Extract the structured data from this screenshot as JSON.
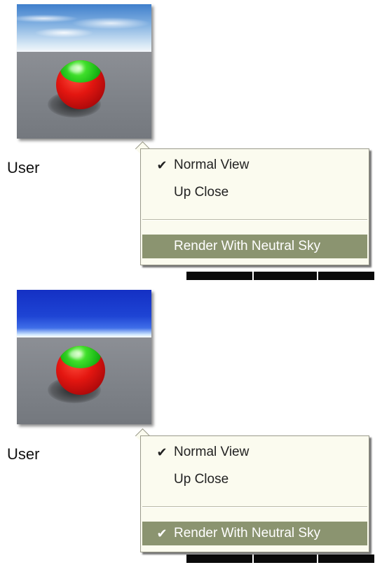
{
  "panels": [
    {
      "sky": "cloudy",
      "profile_label": "User",
      "menu": {
        "items": [
          {
            "label": "Normal View",
            "checked": true
          },
          {
            "label": "Up Close",
            "checked": false
          },
          {
            "label": "Render With Neutral Sky",
            "checked": false,
            "highlighted": true
          }
        ],
        "check_glyph": "✔"
      }
    },
    {
      "sky": "neutral",
      "profile_label": "User",
      "menu": {
        "items": [
          {
            "label": "Normal View",
            "checked": true
          },
          {
            "label": "Up Close",
            "checked": false
          },
          {
            "label": "Render With Neutral Sky",
            "checked": true,
            "highlighted": true
          }
        ],
        "check_glyph": "✔"
      }
    }
  ],
  "colors": {
    "menu_bg": "#fbfbef",
    "menu_highlight": "#8b9470",
    "ball_red": "#e31610",
    "ball_green": "#19b715"
  }
}
